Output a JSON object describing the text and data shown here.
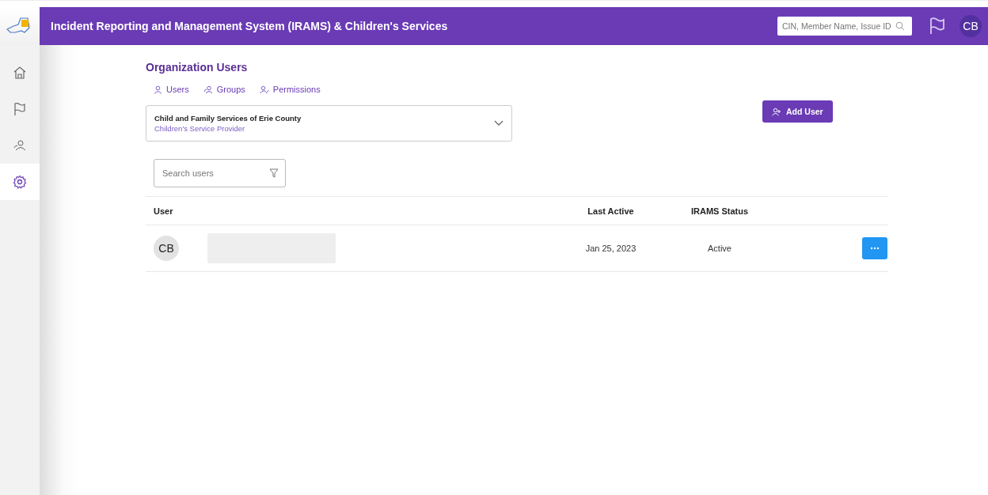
{
  "header": {
    "title": "Incident Reporting and Management System (IRAMS) & Children's Services",
    "search": {
      "placeholder": "CIN, Member Name, Issue ID"
    },
    "avatar": "CB"
  },
  "sidebar": {
    "items": [
      {
        "kind": "home",
        "selected": false
      },
      {
        "kind": "flag",
        "selected": false
      },
      {
        "kind": "people",
        "selected": false
      },
      {
        "kind": "settings",
        "selected": true
      }
    ]
  },
  "page": {
    "title": "Organization Users",
    "tabs": [
      {
        "kind": "user",
        "label": "Users"
      },
      {
        "kind": "group",
        "label": "Groups"
      },
      {
        "kind": "permission",
        "label": "Permissions"
      }
    ],
    "organization": {
      "name": "Child and Family Services of Erie County",
      "type": "Children's Service Provider"
    },
    "add_button": "Add User",
    "search": {
      "placeholder": "Search users"
    }
  },
  "table": {
    "columns": [
      "User",
      "Last Active",
      "IRAMS Status"
    ],
    "rows": [
      {
        "initials": "CB",
        "last_active": "Jan 25, 2023",
        "status": "Active"
      }
    ]
  }
}
